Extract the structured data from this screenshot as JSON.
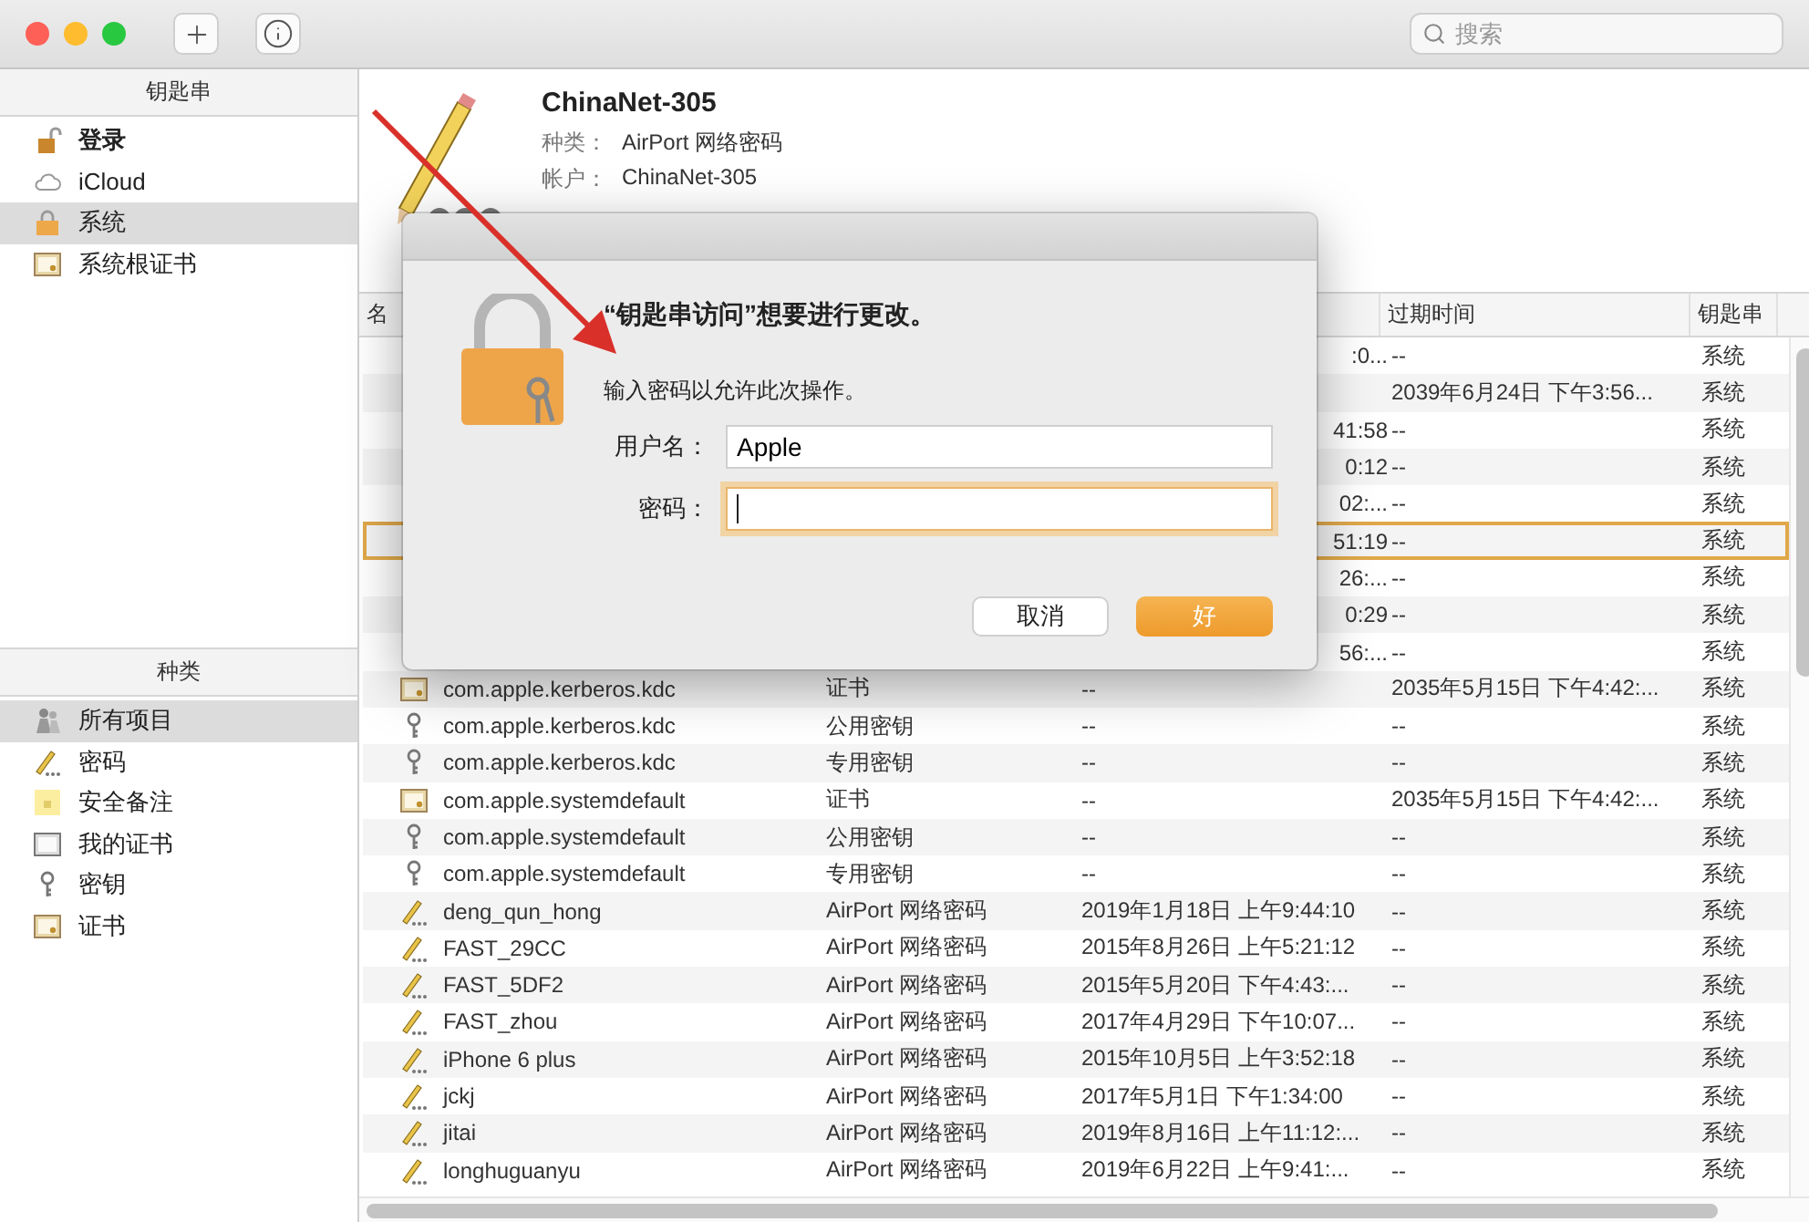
{
  "toolbar": {
    "search": {
      "placeholder": "搜索"
    }
  },
  "keychains": {
    "title": "钥匙串",
    "items": [
      {
        "label": "登录",
        "kind": "unlocked",
        "default": true,
        "selected": false
      },
      {
        "label": "iCloud",
        "kind": "cloud",
        "default": false,
        "selected": false
      },
      {
        "label": "系统",
        "kind": "lock",
        "default": false,
        "selected": true
      },
      {
        "label": "系统根证书",
        "kind": "cert",
        "default": false,
        "selected": false
      }
    ]
  },
  "categories": {
    "title": "种类",
    "items": [
      {
        "label": "所有项目",
        "kind": "people",
        "selected": true
      },
      {
        "label": "密码",
        "kind": "pencil",
        "selected": false
      },
      {
        "label": "安全备注",
        "kind": "note",
        "selected": false
      },
      {
        "label": "我的证书",
        "kind": "mycert",
        "selected": false
      },
      {
        "label": "密钥",
        "kind": "key",
        "selected": false
      },
      {
        "label": "证书",
        "kind": "cert",
        "selected": false
      }
    ]
  },
  "detail": {
    "title": "ChinaNet-305",
    "fields": [
      {
        "label": "种类：",
        "value": "AirPort 网络密码"
      },
      {
        "label": "帐户：",
        "value": "ChinaNet-305"
      }
    ]
  },
  "table": {
    "column_headers": {
      "name": "名",
      "expiry": "过期时间",
      "keychain": "钥匙串"
    },
    "rows": [
      {
        "modified": ":0...",
        "expiry": "--",
        "keychain": "系统",
        "selected": false
      },
      {
        "expiry": "2039年6月24日 下午3:56...",
        "keychain": "系统",
        "selected": false
      },
      {
        "modified": "41:58",
        "expiry": "--",
        "keychain": "系统",
        "selected": false
      },
      {
        "modified": "0:12",
        "expiry": "--",
        "keychain": "系统",
        "selected": false
      },
      {
        "modified": "02:...",
        "expiry": "--",
        "keychain": "系统",
        "selected": false
      },
      {
        "modified": "51:19",
        "expiry": "--",
        "keychain": "系统",
        "selected": true
      },
      {
        "modified": "26:...",
        "expiry": "--",
        "keychain": "系统",
        "selected": false
      },
      {
        "modified": "0:29",
        "expiry": "--",
        "keychain": "系统",
        "selected": false
      },
      {
        "modified": "56:...",
        "expiry": "--",
        "keychain": "系统",
        "selected": false
      },
      {
        "kind": "cert",
        "name": "com.apple.kerberos.kdc",
        "type": "证书",
        "modified": "--",
        "expiry": "2035年5月15日 下午4:42:...",
        "keychain": "系统",
        "selected": false
      },
      {
        "kind": "key",
        "name": "com.apple.kerberos.kdc",
        "type": "公用密钥",
        "modified": "--",
        "expiry": "--",
        "keychain": "系统",
        "selected": false
      },
      {
        "kind": "key",
        "name": "com.apple.kerberos.kdc",
        "type": "专用密钥",
        "modified": "--",
        "expiry": "--",
        "keychain": "系统",
        "selected": false
      },
      {
        "kind": "cert",
        "name": "com.apple.systemdefault",
        "type": "证书",
        "modified": "--",
        "expiry": "2035年5月15日 下午4:42:...",
        "keychain": "系统",
        "selected": false
      },
      {
        "kind": "key",
        "name": "com.apple.systemdefault",
        "type": "公用密钥",
        "modified": "--",
        "expiry": "--",
        "keychain": "系统",
        "selected": false
      },
      {
        "kind": "key",
        "name": "com.apple.systemdefault",
        "type": "专用密钥",
        "modified": "--",
        "expiry": "--",
        "keychain": "系统",
        "selected": false
      },
      {
        "kind": "pencil",
        "name": "deng_qun_hong",
        "type": "AirPort 网络密码",
        "modified": "2019年1月18日 上午9:44:10",
        "expiry": "--",
        "keychain": "系统",
        "selected": false
      },
      {
        "kind": "pencil",
        "name": "FAST_29CC",
        "type": "AirPort 网络密码",
        "modified": "2015年8月26日 上午5:21:12",
        "expiry": "--",
        "keychain": "系统",
        "selected": false
      },
      {
        "kind": "pencil",
        "name": "FAST_5DF2",
        "type": "AirPort 网络密码",
        "modified": "2015年5月20日 下午4:43:...",
        "expiry": "--",
        "keychain": "系统",
        "selected": false
      },
      {
        "kind": "pencil",
        "name": "FAST_zhou",
        "type": "AirPort 网络密码",
        "modified": "2017年4月29日 下午10:07...",
        "expiry": "--",
        "keychain": "系统",
        "selected": false
      },
      {
        "kind": "pencil",
        "name": "iPhone 6 plus",
        "type": "AirPort 网络密码",
        "modified": "2015年10月5日 上午3:52:18",
        "expiry": "--",
        "keychain": "系统",
        "selected": false
      },
      {
        "kind": "pencil",
        "name": "jckj",
        "type": "AirPort 网络密码",
        "modified": "2017年5月1日 下午1:34:00",
        "expiry": "--",
        "keychain": "系统",
        "selected": false
      },
      {
        "kind": "pencil",
        "name": "jitai",
        "type": "AirPort 网络密码",
        "modified": "2019年8月16日 上午11:12:...",
        "expiry": "--",
        "keychain": "系统",
        "selected": false
      },
      {
        "kind": "pencil",
        "name": "longhuguanyu",
        "type": "AirPort 网络密码",
        "modified": "2019年6月22日 上午9:41:...",
        "expiry": "--",
        "keychain": "系统",
        "selected": false
      }
    ]
  },
  "dialog": {
    "title": "“钥匙串访问”想要进行更改。",
    "message": "输入密码以允许此次操作。",
    "fields": [
      {
        "label": "用户名：",
        "value": "Apple",
        "focused": false
      },
      {
        "label": "密码：",
        "focused": true
      }
    ],
    "buttons": [
      {
        "label": "取消",
        "default": false
      },
      {
        "label": "好",
        "default": true
      }
    ]
  }
}
